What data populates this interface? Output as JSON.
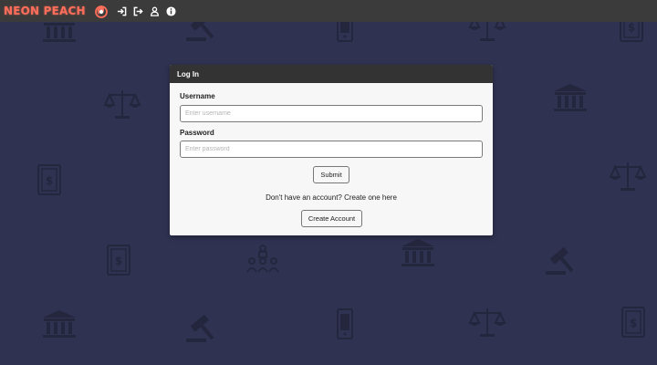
{
  "navbar": {
    "brand": "NEON PEACH",
    "icons": [
      "fire-logo-icon",
      "login-icon",
      "logout-icon",
      "user-icon",
      "info-icon"
    ]
  },
  "login_card": {
    "title": "Log In",
    "username_label": "Username",
    "username_placeholder": "Enter username",
    "username_value": "",
    "password_label": "Password",
    "password_placeholder": "Enter password",
    "password_value": "",
    "submit_label": "Submit",
    "no_account_text": "Don't have an account? Create one here",
    "create_account_label": "Create Account"
  },
  "background": {
    "pattern_icons": [
      "courthouse-icon",
      "gavel-icon",
      "scales-icon",
      "legal-document-icon",
      "jury-icon",
      "phone-icon"
    ]
  },
  "colors": {
    "background": "#2f3251",
    "navbar": "#3b3b3b",
    "brand": "#ff6e5a",
    "card_header": "#333333",
    "card_body": "#f7f7f7"
  }
}
